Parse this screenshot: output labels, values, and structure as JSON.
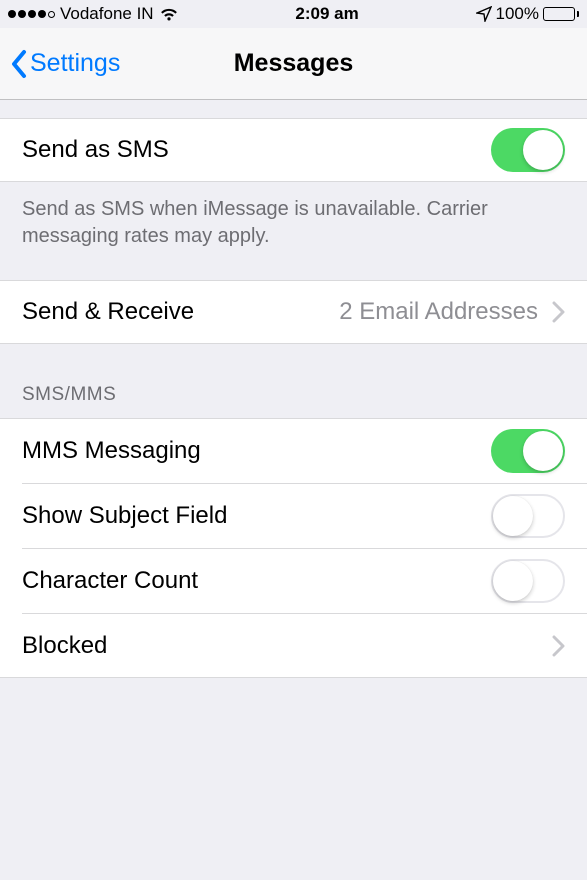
{
  "status": {
    "carrier": "Vodafone IN",
    "time": "2:09 am",
    "battery_pct": "100%"
  },
  "nav": {
    "back_label": "Settings",
    "title": "Messages"
  },
  "rows": {
    "send_as_sms": {
      "label": "Send as SMS",
      "on": true
    },
    "send_as_sms_footer": "Send as SMS when iMessage is unavailable. Carrier messaging rates may apply.",
    "send_receive": {
      "label": "Send & Receive",
      "detail": "2 Email Addresses"
    },
    "section_sms_mms": "SMS/MMS",
    "mms_messaging": {
      "label": "MMS Messaging",
      "on": true
    },
    "show_subject": {
      "label": "Show Subject Field",
      "on": false
    },
    "char_count": {
      "label": "Character Count",
      "on": false
    },
    "blocked": {
      "label": "Blocked"
    }
  }
}
